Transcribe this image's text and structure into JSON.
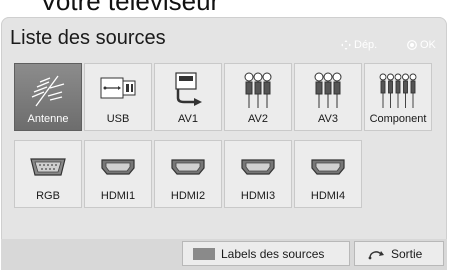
{
  "page_fragment": "Votre téléviseur",
  "header": {
    "title": "Liste des sources",
    "hint_move": "Dép.",
    "hint_ok": "OK"
  },
  "sources": [
    {
      "label": "Antenne",
      "icon": "antenna-icon",
      "selected": true
    },
    {
      "label": "USB",
      "icon": "usb-icon",
      "selected": false
    },
    {
      "label": "AV1",
      "icon": "scart-icon",
      "selected": false
    },
    {
      "label": "AV2",
      "icon": "rca-three-icon",
      "selected": false
    },
    {
      "label": "AV3",
      "icon": "rca-three-icon",
      "selected": false
    },
    {
      "label": "Component",
      "icon": "rca-five-icon",
      "selected": false
    },
    {
      "label": "RGB",
      "icon": "vga-port-icon",
      "selected": false
    },
    {
      "label": "HDMI1",
      "icon": "hdmi-port-icon",
      "selected": false
    },
    {
      "label": "HDMI2",
      "icon": "hdmi-port-icon",
      "selected": false
    },
    {
      "label": "HDMI3",
      "icon": "hdmi-port-icon",
      "selected": false
    },
    {
      "label": "HDMI4",
      "icon": "hdmi-port-icon",
      "selected": false
    }
  ],
  "footer": {
    "labels_button": "Labels des sources",
    "exit_button": "Sortie"
  },
  "colors": {
    "panel": "#e4e4e4",
    "tile": "#ececec",
    "tile_selected": "#7a7a7a"
  }
}
